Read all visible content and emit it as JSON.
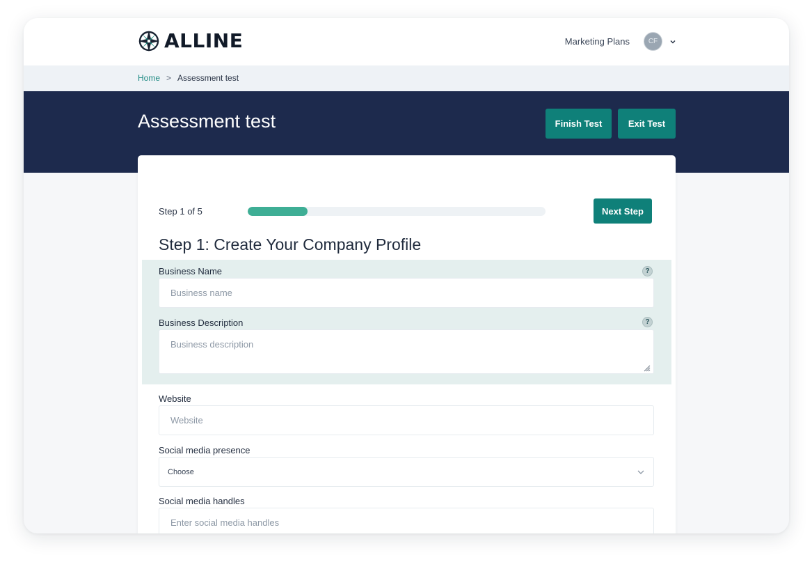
{
  "header": {
    "brand": "ALLINE",
    "nav_link": "Marketing Plans",
    "avatar_initials": "CF"
  },
  "breadcrumb": {
    "home": "Home",
    "separator": ">",
    "current": "Assessment test"
  },
  "banner": {
    "title": "Assessment test",
    "finish_label": "Finish Test",
    "exit_label": "Exit Test"
  },
  "step": {
    "label": "Step 1 of 5",
    "progress": 0.2,
    "next_label": "Next Step",
    "heading": "Step 1: Create Your Company Profile"
  },
  "form": {
    "business_name": {
      "label": "Business Name",
      "placeholder": "Business name",
      "help": "?"
    },
    "business_description": {
      "label": "Business Description",
      "placeholder": "Business description",
      "help": "?"
    },
    "website": {
      "label": "Website",
      "placeholder": "Website"
    },
    "social_presence": {
      "label": "Social media presence",
      "selected": "Choose"
    },
    "social_handles": {
      "label": "Social media handles",
      "placeholder": "Enter social media handles"
    }
  },
  "colors": {
    "navy": "#1d2a4d",
    "teal": "#0f8079",
    "progress": "#3eae95",
    "highlight": "#e4efee",
    "link": "#1f8a83"
  }
}
